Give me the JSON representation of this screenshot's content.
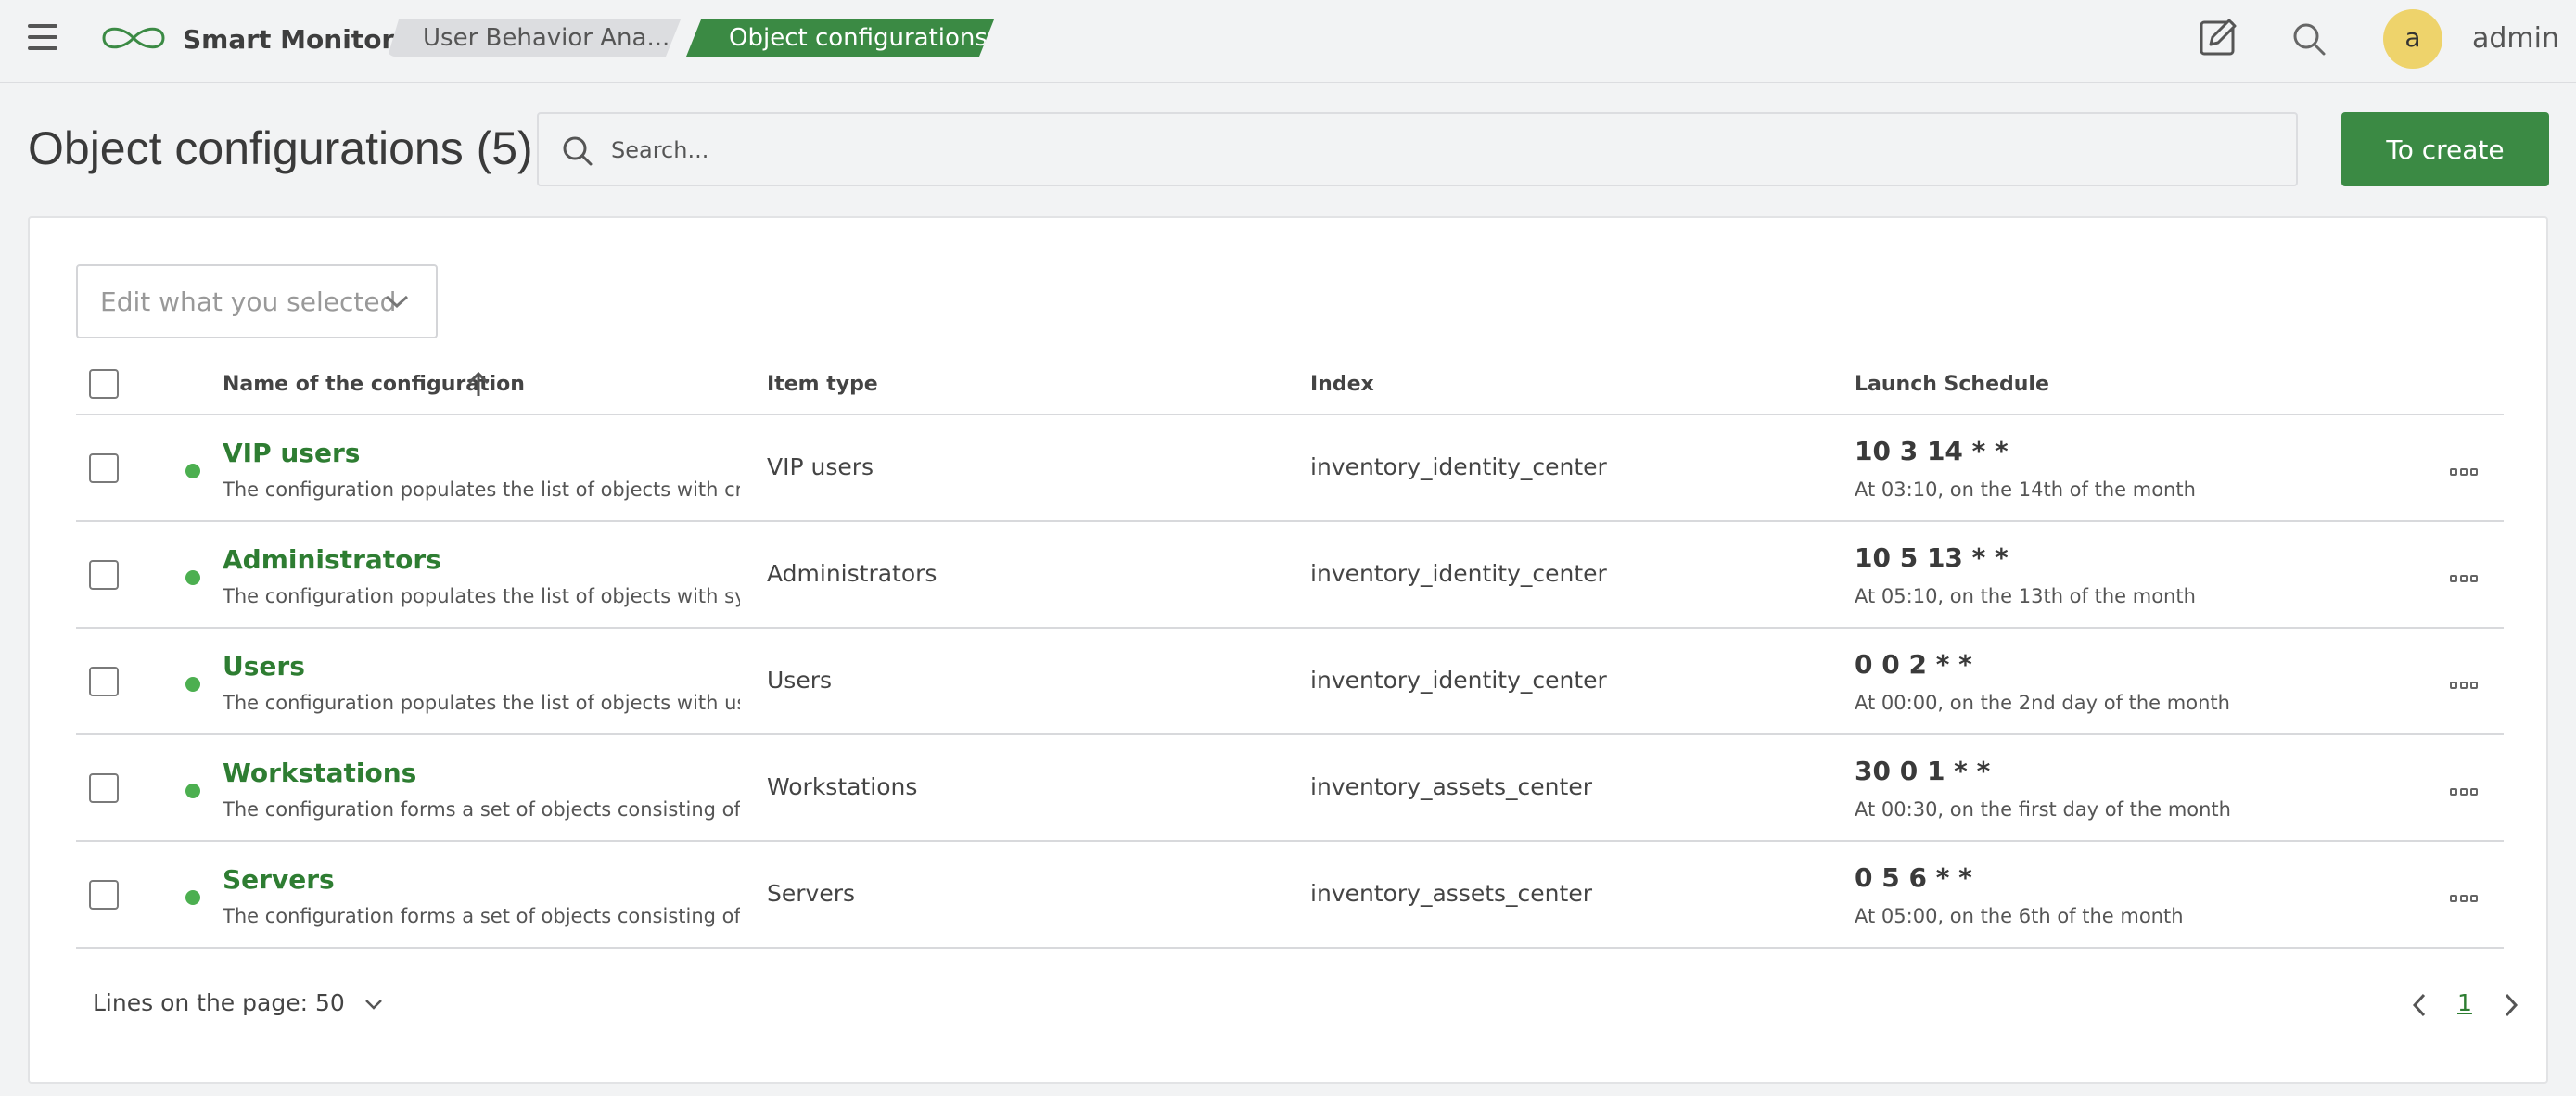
{
  "header": {
    "app_name": "Smart Monitor",
    "breadcrumbs": [
      "User Behavior Ana...",
      "Object configurations"
    ],
    "username": "admin",
    "avatar_letter": "a"
  },
  "page": {
    "title": "Object configurations (5)",
    "search_placeholder": "Search...",
    "create_label": "To create",
    "bulk_edit_placeholder": "Edit what you selected"
  },
  "table": {
    "columns": [
      "Name of the configuration",
      "Item type",
      "Index",
      "Launch Schedule"
    ],
    "rows": [
      {
        "name": "VIP users",
        "description": "The configuration populates the list of objects with critica",
        "item_type": "VIP users",
        "index": "inventory_identity_center",
        "cron": "10 3 14 * *",
        "cron_desc": "At 03:10, on the 14th of the month"
      },
      {
        "name": "Administrators",
        "description": "The configuration populates the list of objects with systen",
        "item_type": "Administrators",
        "index": "inventory_identity_center",
        "cron": "10 5 13 * *",
        "cron_desc": "At 05:10, on the 13th of the month"
      },
      {
        "name": "Users",
        "description": "The configuration populates the list of objects with users",
        "item_type": "Users",
        "index": "inventory_identity_center",
        "cron": "0 0 2 * *",
        "cron_desc": "At 00:00, on the 2nd day of the month"
      },
      {
        "name": "Workstations",
        "description": "The configuration forms a set of objects consisting of user",
        "item_type": "Workstations",
        "index": "inventory_assets_center",
        "cron": "30 0 1 * *",
        "cron_desc": "At 00:30, on the first day of the month"
      },
      {
        "name": "Servers",
        "description": "The configuration forms a set of objects consisting of serv",
        "item_type": "Servers",
        "index": "inventory_assets_center",
        "cron": "0 5 6 * *",
        "cron_desc": "At 05:00, on the 6th of the month"
      }
    ]
  },
  "footer": {
    "lines_per_page": "Lines on the page: 50",
    "current_page": "1"
  },
  "colors": {
    "accent": "#3b8a44",
    "status_active": "#4caf50",
    "avatar_bg": "#eed36b"
  },
  "icons": [
    "menu-icon",
    "logo-icon",
    "edit-icon",
    "search-icon",
    "sort-ascending-icon",
    "chevron-down-icon",
    "more-icon",
    "chevron-left-icon",
    "chevron-right-icon"
  ]
}
